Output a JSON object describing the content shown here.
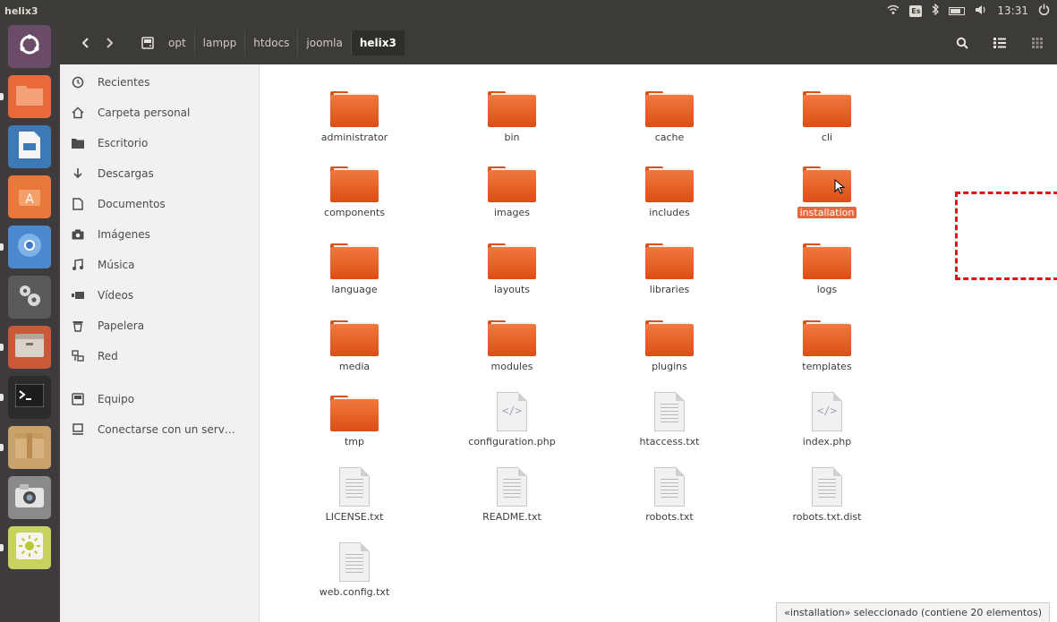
{
  "top_panel": {
    "app_title": "helix3",
    "time": "13:31",
    "keyboard_layout": "Es"
  },
  "launcher": {
    "items": [
      {
        "name": "ubuntu-dash-icon",
        "color": "#6a4b68"
      },
      {
        "name": "files-icon",
        "color": "#e8693a"
      },
      {
        "name": "libreoffice-writer-icon",
        "color": "#3d79b6"
      },
      {
        "name": "software-center-icon",
        "color": "#e9783b"
      },
      {
        "name": "chromium-icon",
        "color": "#4a89cf"
      },
      {
        "name": "system-settings-icon",
        "color": "#5a5a5a"
      },
      {
        "name": "archive-manager-icon",
        "color": "#c85a3a"
      },
      {
        "name": "terminal-icon",
        "color": "#2c2c2c"
      },
      {
        "name": "package-icon",
        "color": "#c9a36b"
      },
      {
        "name": "camera-icon",
        "color": "#8a8a8a"
      },
      {
        "name": "brightness-icon",
        "color": "#c8d25e"
      }
    ]
  },
  "toolbar": {
    "back_icon": "chevron-left-icon",
    "forward_icon": "chevron-right-icon",
    "breadcrumbs": [
      "opt",
      "lampp",
      "htdocs",
      "joomla",
      "helix3"
    ],
    "active_crumb": "helix3"
  },
  "sidebar": {
    "items": [
      {
        "label": "Recientes",
        "icon": "clock-icon"
      },
      {
        "label": "Carpeta personal",
        "icon": "home-icon"
      },
      {
        "label": "Escritorio",
        "icon": "desktop-folder-icon"
      },
      {
        "label": "Descargas",
        "icon": "download-icon"
      },
      {
        "label": "Documentos",
        "icon": "document-icon"
      },
      {
        "label": "Imágenes",
        "icon": "camera-icon"
      },
      {
        "label": "Música",
        "icon": "music-icon"
      },
      {
        "label": "Vídeos",
        "icon": "video-icon"
      },
      {
        "label": "Papelera",
        "icon": "trash-icon"
      },
      {
        "label": "Red",
        "icon": "network-icon"
      },
      {
        "label": "Equipo",
        "icon": "computer-icon"
      },
      {
        "label": "Conectarse con un serv…",
        "icon": "server-icon"
      }
    ]
  },
  "files": [
    {
      "name": "administrator",
      "type": "folder"
    },
    {
      "name": "bin",
      "type": "folder"
    },
    {
      "name": "cache",
      "type": "folder"
    },
    {
      "name": "cli",
      "type": "folder"
    },
    {
      "name": "components",
      "type": "folder"
    },
    {
      "name": "images",
      "type": "folder"
    },
    {
      "name": "includes",
      "type": "folder"
    },
    {
      "name": "installation",
      "type": "folder",
      "selected": true
    },
    {
      "name": "language",
      "type": "folder"
    },
    {
      "name": "layouts",
      "type": "folder"
    },
    {
      "name": "libraries",
      "type": "folder"
    },
    {
      "name": "logs",
      "type": "folder"
    },
    {
      "name": "media",
      "type": "folder"
    },
    {
      "name": "modules",
      "type": "folder"
    },
    {
      "name": "plugins",
      "type": "folder"
    },
    {
      "name": "templates",
      "type": "folder"
    },
    {
      "name": "tmp",
      "type": "folder"
    },
    {
      "name": "configuration.php",
      "type": "php"
    },
    {
      "name": "htaccess.txt",
      "type": "text"
    },
    {
      "name": "index.php",
      "type": "php"
    },
    {
      "name": "LICENSE.txt",
      "type": "text"
    },
    {
      "name": "README.txt",
      "type": "text"
    },
    {
      "name": "robots.txt",
      "type": "text"
    },
    {
      "name": "robots.txt.dist",
      "type": "text"
    },
    {
      "name": "web.config.txt",
      "type": "text"
    }
  ],
  "status": {
    "text": "«installation» seleccionado  (contiene 20 elementos)"
  },
  "colors": {
    "panel": "#3c3b37",
    "folder": "#e8693a",
    "selection": "#e7683d",
    "highlight_box": "#e0141b"
  }
}
